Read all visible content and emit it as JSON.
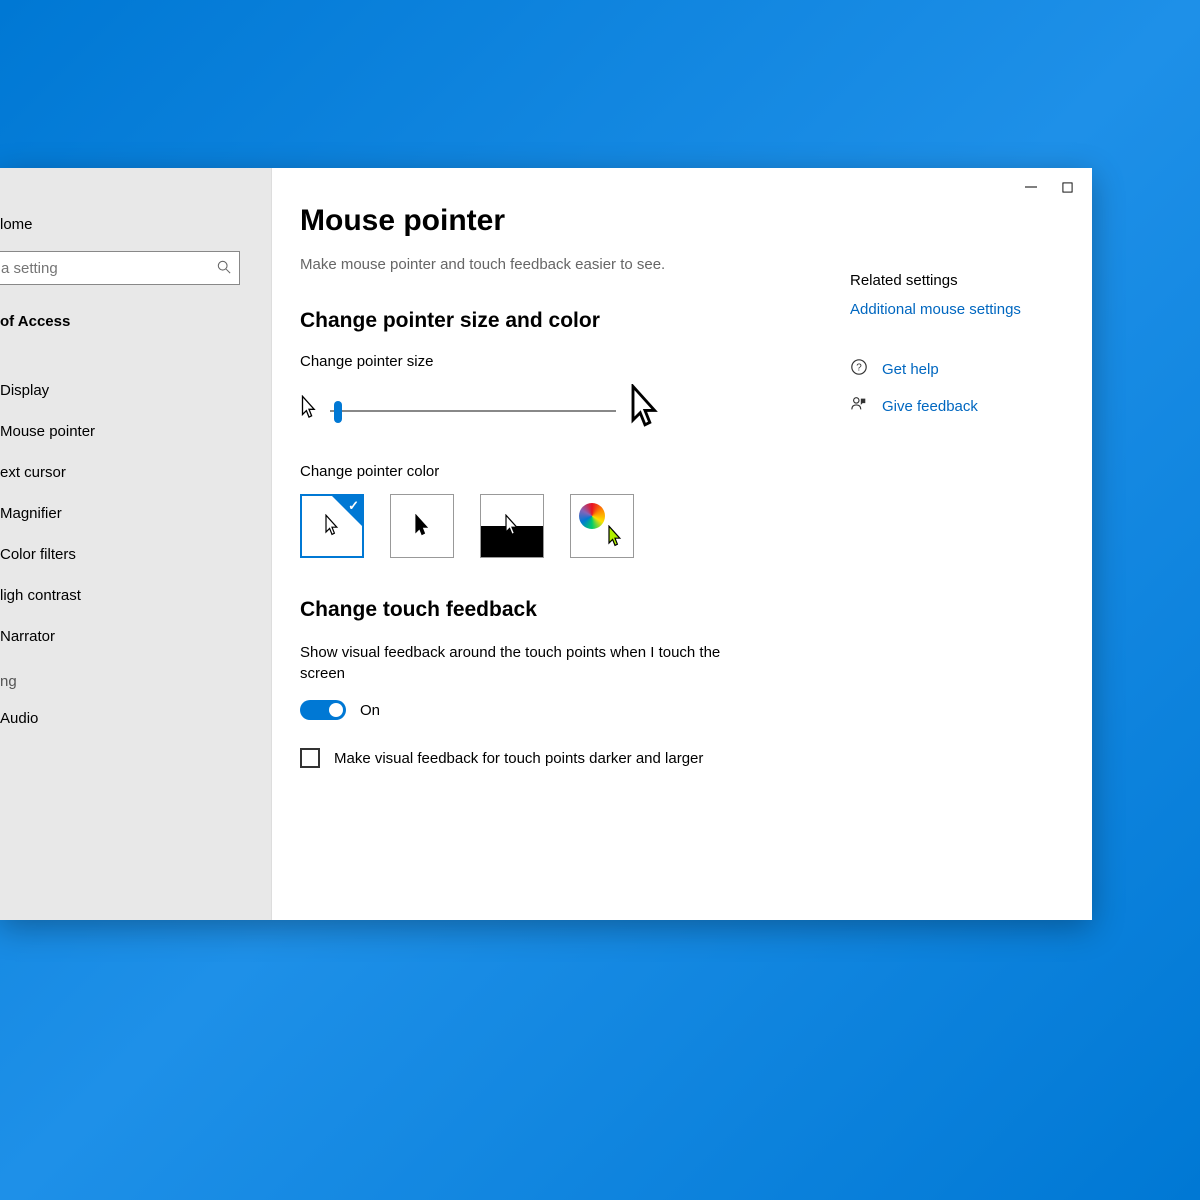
{
  "sidebar": {
    "home": "lome",
    "search_placeholder": "a setting",
    "section": "of Access",
    "items": [
      "Display",
      "Mouse pointer",
      "ext cursor",
      "Magnifier",
      "Color filters",
      "ligh contrast",
      "Narrator"
    ],
    "group2": "ng",
    "items2": [
      "Audio"
    ]
  },
  "page": {
    "title": "Mouse pointer",
    "subtitle": "Make mouse pointer and touch feedback easier to see.",
    "section1": "Change pointer size and color",
    "size_label": "Change pointer size",
    "color_label": "Change pointer color",
    "section2": "Change touch feedback",
    "touch_desc": "Show visual feedback around the touch points when I touch the screen",
    "toggle_state": "On",
    "checkbox_label": "Make visual feedback for touch points darker and larger"
  },
  "side": {
    "related": "Related settings",
    "link": "Additional mouse settings",
    "help": "Get help",
    "feedback": "Give feedback"
  }
}
